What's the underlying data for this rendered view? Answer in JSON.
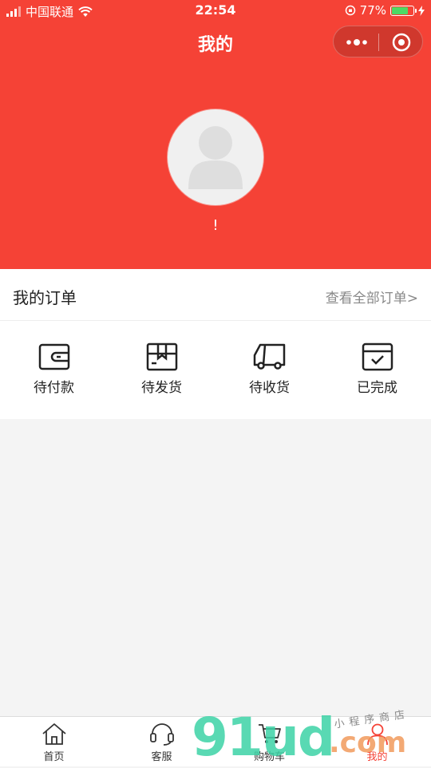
{
  "status_bar": {
    "carrier": "中国联通",
    "time": "22:54",
    "battery_percent": "77%",
    "battery_level": 0.77,
    "battery_color": "#4cd964"
  },
  "header": {
    "title": "我的",
    "background_color": "#f54236",
    "nickname": "!"
  },
  "orders": {
    "title": "我的订单",
    "view_all": "查看全部订单>",
    "items": [
      {
        "label": "待付款",
        "icon": "wallet-icon"
      },
      {
        "label": "待发货",
        "icon": "package-icon"
      },
      {
        "label": "待收货",
        "icon": "delivery-truck-icon"
      },
      {
        "label": "已完成",
        "icon": "calendar-check-icon"
      }
    ]
  },
  "tabbar": {
    "items": [
      {
        "label": "首页",
        "icon": "home-icon",
        "active": false
      },
      {
        "label": "客服",
        "icon": "headset-icon",
        "active": false
      },
      {
        "label": "购物车",
        "icon": "cart-icon",
        "active": false
      },
      {
        "label": "我的",
        "icon": "user-icon",
        "active": true
      }
    ],
    "active_color": "#f54236"
  },
  "watermark": {
    "main": "91ud",
    "domain": ".com",
    "sub": "小程序商店"
  }
}
